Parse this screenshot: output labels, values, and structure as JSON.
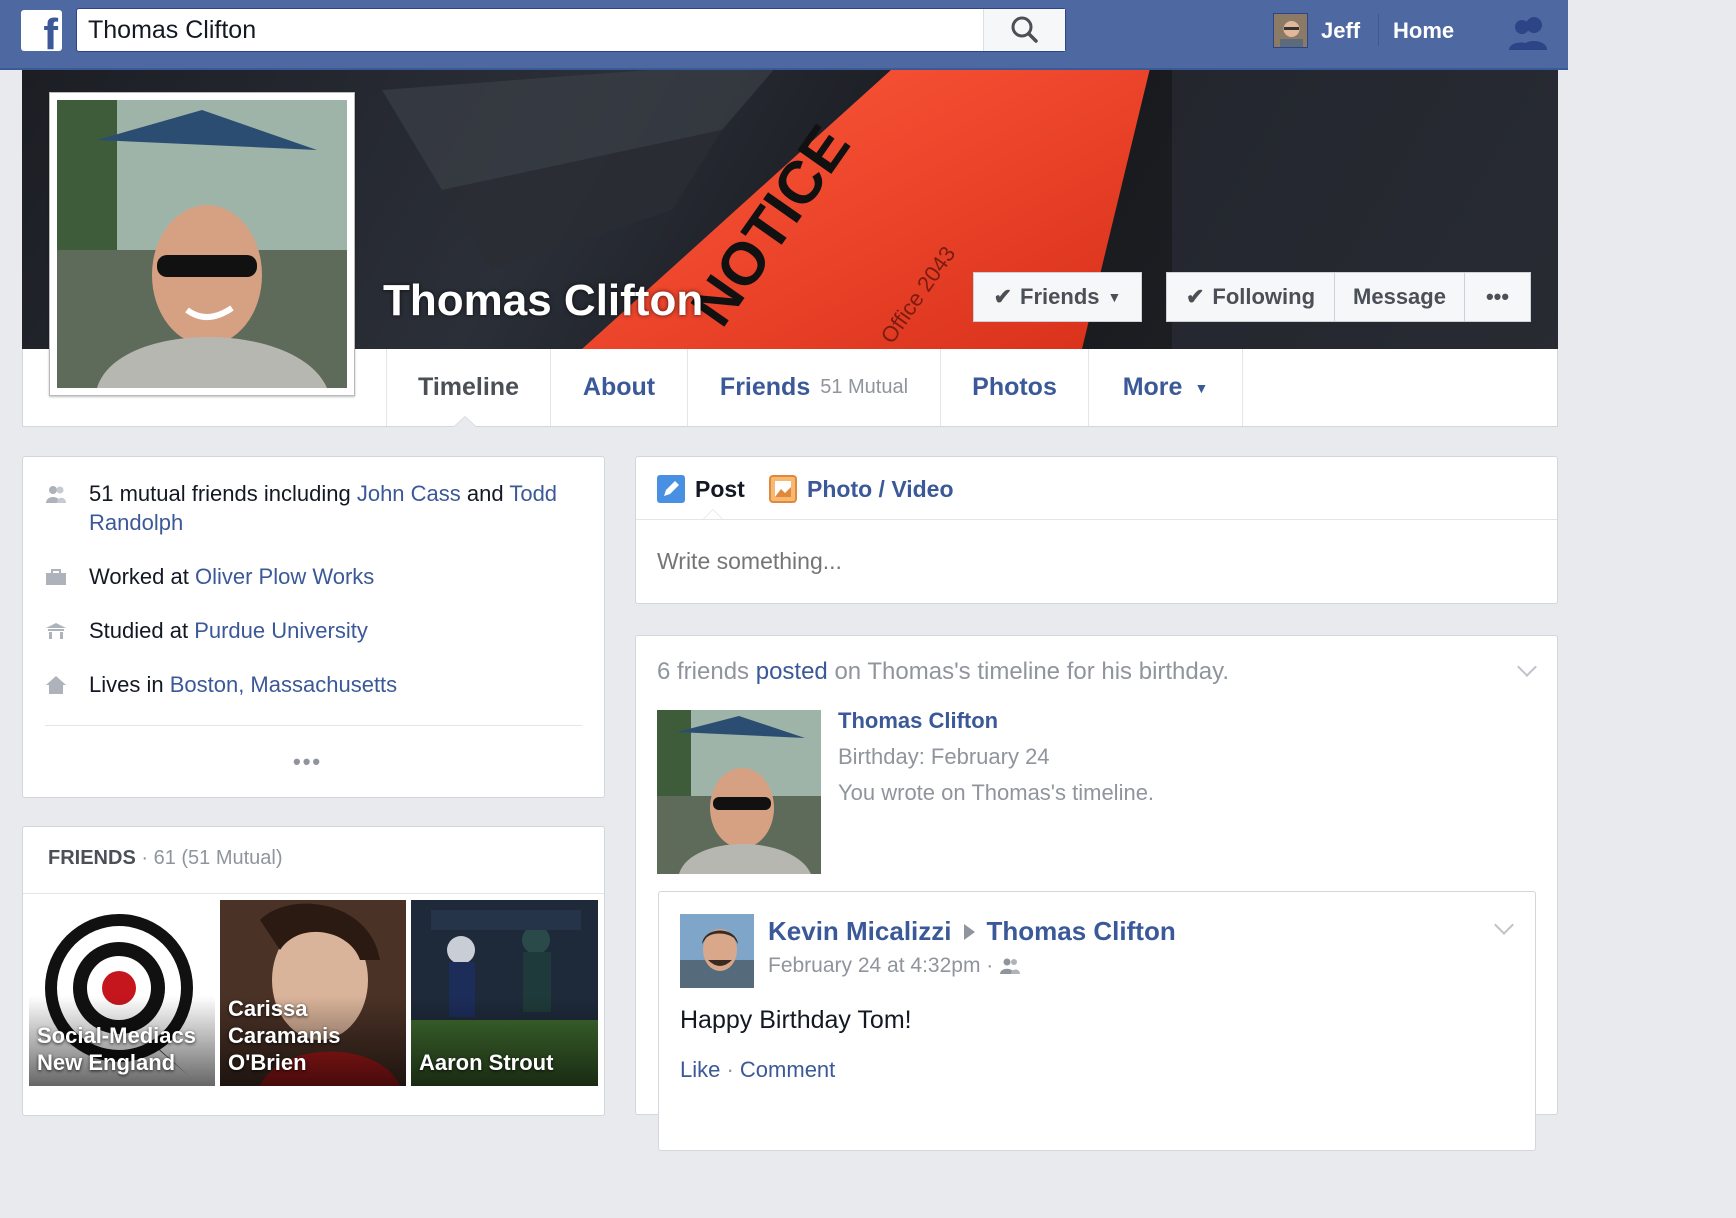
{
  "topbar": {
    "search_value": "Thomas Clifton",
    "user_name": "Jeff",
    "home_label": "Home"
  },
  "profile": {
    "name": "Thomas Clifton",
    "buttons": {
      "friends": "Friends",
      "following": "Following",
      "message": "Message",
      "more": "•••"
    }
  },
  "nav": {
    "timeline": "Timeline",
    "about": "About",
    "friends": "Friends",
    "friends_count": "51 Mutual",
    "photos": "Photos",
    "more": "More"
  },
  "intro": {
    "mutual": {
      "prefix": "51 mutual friends including ",
      "friend1": "John Cass",
      "and": " and ",
      "friend2": "Todd Randolph"
    },
    "work": {
      "prefix": "Worked at ",
      "place": "Oliver Plow Works"
    },
    "study": {
      "prefix": "Studied at ",
      "place": "Purdue University"
    },
    "lives": {
      "prefix": "Lives in ",
      "place": "Boston, Massachusetts"
    },
    "more_dots": "•••"
  },
  "friends_panel": {
    "title": "FRIENDS",
    "count": " · 61 (51 Mutual)",
    "tiles": [
      {
        "name_line1": "Social-Mediacs",
        "name_line2": "New England"
      },
      {
        "name_line1": "Carissa",
        "name_line2": "Caramanis",
        "name_line3": "O'Brien"
      },
      {
        "name_line1": "Aaron Strout"
      }
    ]
  },
  "composer": {
    "post_tab": "Post",
    "photo_tab": "Photo / Video",
    "placeholder": "Write something..."
  },
  "feed": {
    "headline_prefix": "6 friends ",
    "headline_link": "posted",
    "headline_suffix": " on Thomas's timeline for his birthday.",
    "birthday_name": "Thomas Clifton",
    "birthday_date": "Birthday: February 24",
    "birthday_note": "You wrote on Thomas's timeline.",
    "post": {
      "author": "Kevin Micalizzi",
      "target": "Thomas Clifton",
      "time": "February 24 at 4:32pm ·",
      "body": "Happy Birthday Tom!",
      "like": "Like",
      "sep": " · ",
      "comment": "Comment"
    }
  },
  "colors": {
    "brand_blue": "#3b5998",
    "topbar": "#4e69a2",
    "background": "#e9eaed"
  }
}
